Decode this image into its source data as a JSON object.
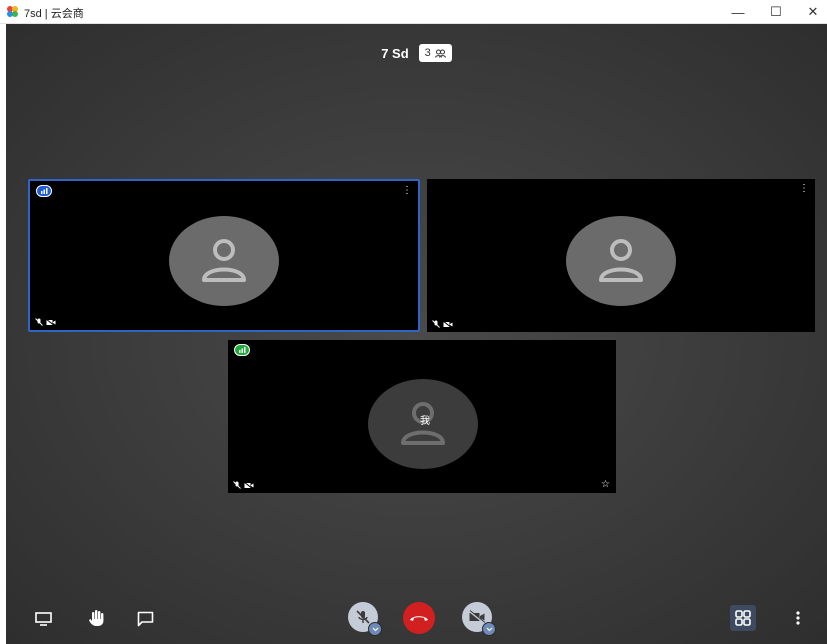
{
  "window": {
    "title": "7sd | 云会商",
    "minimize_glyph": "—",
    "maximize_glyph": "☐",
    "close_glyph": "✕",
    "app_icon": "colorful-pinwheel-icon"
  },
  "meeting": {
    "name": "7 Sd",
    "participant_count": "3",
    "participants_icon": "participants-icon"
  },
  "tiles": [
    {
      "kind": "remote",
      "active": true,
      "connection": "blue",
      "menu_glyph": "⋮"
    },
    {
      "kind": "remote",
      "active": false,
      "menu_glyph": "⋮"
    },
    {
      "kind": "self",
      "label": "我",
      "connection": "green",
      "star_glyph": "☆"
    }
  ],
  "toolbar": {
    "left": [
      "screen-share-icon",
      "raise-hand-icon",
      "chat-icon"
    ],
    "center": [
      "mic-muted-button",
      "hangup-button",
      "camera-off-button"
    ],
    "right": [
      "tile-view-button",
      "more-options-button"
    ],
    "colors": {
      "hangup": "#d21f1f",
      "toggle": "#c5ccd8",
      "tile_view_bg": "#3d4a60"
    }
  }
}
